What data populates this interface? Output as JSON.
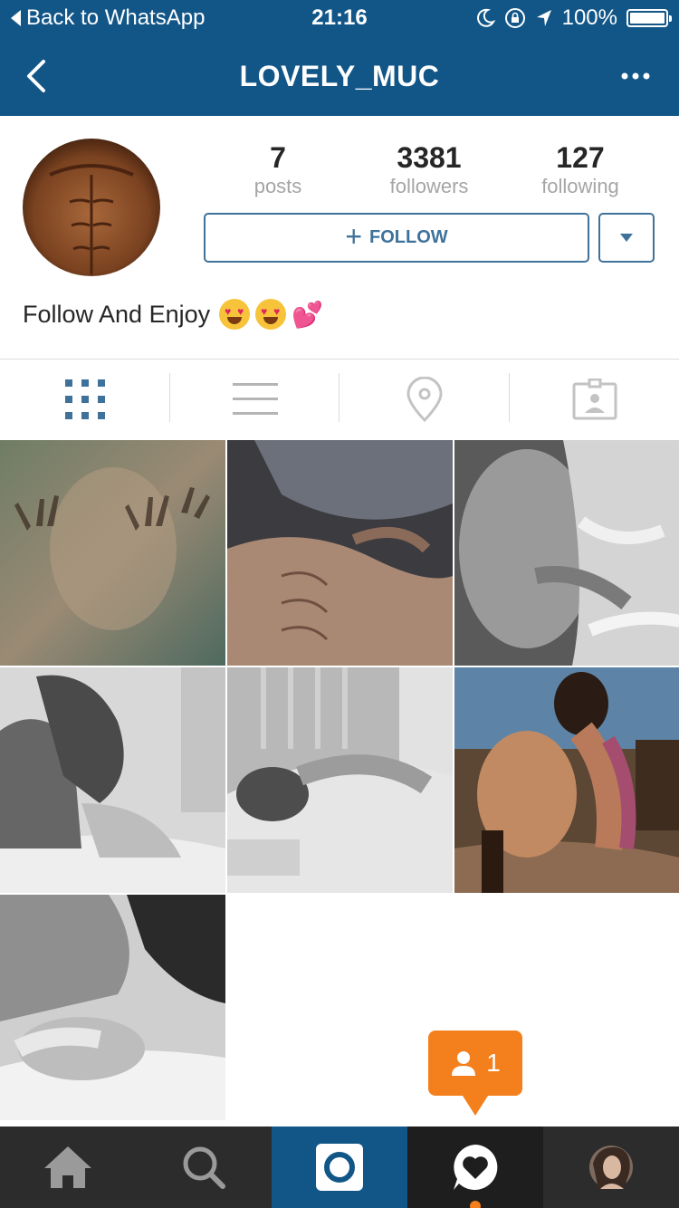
{
  "status_bar": {
    "back_app": "Back to WhatsApp",
    "time": "21:16",
    "battery_percent": "100%",
    "battery_level": 1.0,
    "icons": [
      "moon-icon",
      "rotation-lock-icon",
      "location-arrow-icon",
      "battery-icon"
    ]
  },
  "nav": {
    "title": "LOVELY_MUC",
    "back_icon": "chevron-left-icon",
    "more_icon": "more-dots-icon"
  },
  "profile": {
    "stats": [
      {
        "value": "7",
        "label": "posts"
      },
      {
        "value": "3381",
        "label": "followers"
      },
      {
        "value": "127",
        "label": "following"
      }
    ],
    "follow_label": "FOLLOW",
    "bio": "Follow And Enjoy"
  },
  "tabs": [
    "grid-view-icon",
    "list-view-icon",
    "location-pin-icon",
    "tagged-photos-icon"
  ],
  "posts": [
    {
      "id": "post-1",
      "tone": "green"
    },
    {
      "id": "post-2",
      "tone": "dark"
    },
    {
      "id": "post-3",
      "tone": "grey"
    },
    {
      "id": "post-4",
      "tone": "grey"
    },
    {
      "id": "post-5",
      "tone": "grey"
    },
    {
      "id": "post-6",
      "tone": "warm"
    },
    {
      "id": "post-7",
      "tone": "grey"
    }
  ],
  "notification": {
    "count": "1",
    "icon": "person-icon"
  },
  "bottom_nav": [
    "home-icon",
    "search-icon",
    "camera-icon",
    "activity-heart-icon",
    "profile-avatar"
  ],
  "colors": {
    "brand_blue": "#125688",
    "button_blue": "#3f729b",
    "notification_orange": "#f47f1d",
    "tabbar": "#2c2c2c"
  }
}
